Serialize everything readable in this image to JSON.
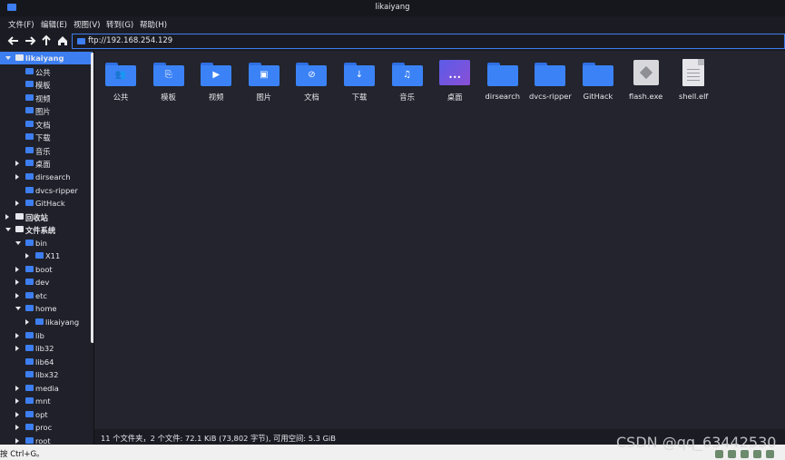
{
  "window": {
    "title": "likaiyang"
  },
  "menu": [
    "文件(F)",
    "编辑(E)",
    "视图(V)",
    "转到(G)",
    "帮助(H)"
  ],
  "address": {
    "value": "ftp://192.168.254.129"
  },
  "sidebar": {
    "items": [
      {
        "label": "likaiyang",
        "bold": true,
        "selected": true,
        "indent": 0,
        "arrow": "down",
        "icon": "upload-home-icon"
      },
      {
        "label": "公共",
        "indent": 1,
        "arrow": "",
        "icon": "folder-icon"
      },
      {
        "label": "模板",
        "indent": 1,
        "arrow": "",
        "icon": "folder-icon"
      },
      {
        "label": "视频",
        "indent": 1,
        "arrow": "",
        "icon": "folder-icon"
      },
      {
        "label": "图片",
        "indent": 1,
        "arrow": "",
        "icon": "folder-icon"
      },
      {
        "label": "文档",
        "indent": 1,
        "arrow": "",
        "icon": "folder-icon"
      },
      {
        "label": "下载",
        "indent": 1,
        "arrow": "",
        "icon": "folder-icon"
      },
      {
        "label": "音乐",
        "indent": 1,
        "arrow": "",
        "icon": "folder-icon"
      },
      {
        "label": "桌面",
        "indent": 1,
        "arrow": "right",
        "icon": "desktop-icon"
      },
      {
        "label": "dirsearch",
        "indent": 1,
        "arrow": "right",
        "icon": "folder-icon"
      },
      {
        "label": "dvcs-ripper",
        "indent": 1,
        "arrow": "",
        "icon": "folder-icon"
      },
      {
        "label": "GitHack",
        "indent": 1,
        "arrow": "right",
        "icon": "folder-icon"
      },
      {
        "label": "回收站",
        "bold": true,
        "indent": 0,
        "arrow": "right",
        "icon": "trash-icon"
      },
      {
        "label": "文件系统",
        "bold": true,
        "indent": 0,
        "arrow": "down",
        "icon": "drive-icon"
      },
      {
        "label": "bin",
        "indent": 1,
        "arrow": "down",
        "icon": "folder-open-icon"
      },
      {
        "label": "X11",
        "indent": 2,
        "arrow": "right",
        "icon": "folder-icon"
      },
      {
        "label": "boot",
        "indent": 1,
        "arrow": "right",
        "icon": "folder-icon"
      },
      {
        "label": "dev",
        "indent": 1,
        "arrow": "right",
        "icon": "folder-icon"
      },
      {
        "label": "etc",
        "indent": 1,
        "arrow": "right",
        "icon": "folder-icon"
      },
      {
        "label": "home",
        "indent": 1,
        "arrow": "down",
        "icon": "folder-open-icon"
      },
      {
        "label": "likaiyang",
        "indent": 2,
        "arrow": "right",
        "icon": "home-folder-icon"
      },
      {
        "label": "lib",
        "indent": 1,
        "arrow": "right",
        "icon": "folder-icon"
      },
      {
        "label": "lib32",
        "indent": 1,
        "arrow": "right",
        "icon": "folder-icon"
      },
      {
        "label": "lib64",
        "indent": 1,
        "arrow": "",
        "icon": "folder-icon"
      },
      {
        "label": "libx32",
        "indent": 1,
        "arrow": "",
        "icon": "folder-icon"
      },
      {
        "label": "media",
        "indent": 1,
        "arrow": "right",
        "icon": "folder-icon"
      },
      {
        "label": "mnt",
        "indent": 1,
        "arrow": "right",
        "icon": "folder-icon"
      },
      {
        "label": "opt",
        "indent": 1,
        "arrow": "right",
        "icon": "folder-icon"
      },
      {
        "label": "proc",
        "indent": 1,
        "arrow": "right",
        "icon": "folder-icon"
      },
      {
        "label": "root",
        "indent": 1,
        "arrow": "right",
        "icon": "folder-icon"
      }
    ]
  },
  "files": [
    {
      "name": "公共",
      "kind": "folder",
      "icon": "people-icon",
      "glyph": "👥"
    },
    {
      "name": "模板",
      "kind": "folder",
      "icon": "template-icon",
      "glyph": "⎘"
    },
    {
      "name": "视频",
      "kind": "folder",
      "icon": "video-icon",
      "glyph": "▶"
    },
    {
      "name": "图片",
      "kind": "folder",
      "icon": "image-icon",
      "glyph": "▣"
    },
    {
      "name": "文档",
      "kind": "folder",
      "icon": "paperclip-icon",
      "glyph": "⊘"
    },
    {
      "name": "下载",
      "kind": "folder",
      "icon": "download-icon",
      "glyph": "↓"
    },
    {
      "name": "音乐",
      "kind": "folder",
      "icon": "music-icon",
      "glyph": "♫"
    },
    {
      "name": "桌面",
      "kind": "desktop",
      "icon": "desktop-icon",
      "glyph": "•••"
    },
    {
      "name": "dirsearch",
      "kind": "folder",
      "icon": "folder-icon",
      "glyph": ""
    },
    {
      "name": "dvcs-ripper",
      "kind": "folder",
      "icon": "folder-icon",
      "glyph": ""
    },
    {
      "name": "GitHack",
      "kind": "folder",
      "icon": "folder-icon",
      "glyph": ""
    },
    {
      "name": "flash.exe",
      "kind": "exe",
      "icon": "executable-icon",
      "glyph": ""
    },
    {
      "name": "shell.elf",
      "kind": "doc",
      "icon": "document-icon",
      "glyph": ""
    }
  ],
  "status": {
    "text": "11 个文件夹，2 个文件: 72.1 KiB (73,802 字节), 可用空间: 5.3 GiB"
  },
  "host": {
    "hint": "按 Ctrl+G。"
  },
  "watermark": "CSDN @qq_63442530",
  "colors": {
    "accent": "#3d7ef0",
    "folder": "#3b82f6",
    "bg": "#23242d"
  }
}
